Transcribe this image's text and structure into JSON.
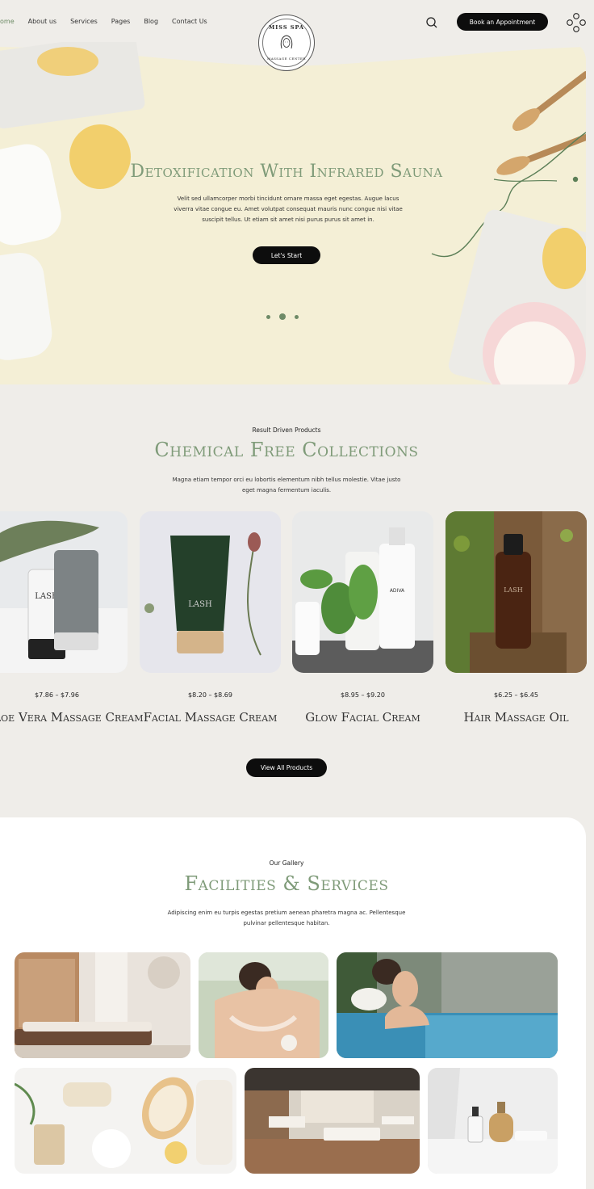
{
  "nav": {
    "links": [
      "Home",
      "About us",
      "Services",
      "Pages",
      "Blog",
      "Contact Us"
    ],
    "active": "Home",
    "book_label": "Book an Appointment"
  },
  "logo": {
    "top_text": "MISS SPA",
    "bottom_text": "MASSAGE CENTER"
  },
  "hero": {
    "title": "Detoxification With Infrared Sauna",
    "text": "Velit sed ullamcorper morbi tincidunt ornare massa eget egestas. Augue lacus viverra vitae congue eu. Amet volutpat consequat mauris nunc congue nisi vitae suscipit tellus. Ut etiam sit amet nisi purus purus sit amet in.",
    "button": "Let's Start",
    "slides": 3,
    "active_slide": 2
  },
  "products": {
    "subtitle": "Result Driven Products",
    "title": "Chemical Free Collections",
    "text": "Magna etiam tempor orci eu lobortis elementum nibh tellus molestie. Vitae justo eget magna fermentum iaculis.",
    "items": [
      {
        "price": "$7.86 – $7.96",
        "name": "Aloe Vera Massage Cream"
      },
      {
        "price": "$8.20 – $8.69",
        "name": "Facial Massage Cream"
      },
      {
        "price": "$8.95 – $9.20",
        "name": "Glow Facial Cream"
      },
      {
        "price": "$6.25 – $6.45",
        "name": "Hair Massage Oil"
      }
    ],
    "button": "View All Products"
  },
  "gallery": {
    "subtitle": "Our Gallery",
    "title": "Facilities & Services",
    "text": "Adipiscing enim eu turpis egestas pretium aenean pharetra magna ac. Pellentesque pulvinar pellentesque habitan."
  },
  "colors": {
    "accent": "#7f9b79",
    "dark": "#0d0d0d",
    "background": "#efede9",
    "hero_bg": "#f4efd6"
  }
}
